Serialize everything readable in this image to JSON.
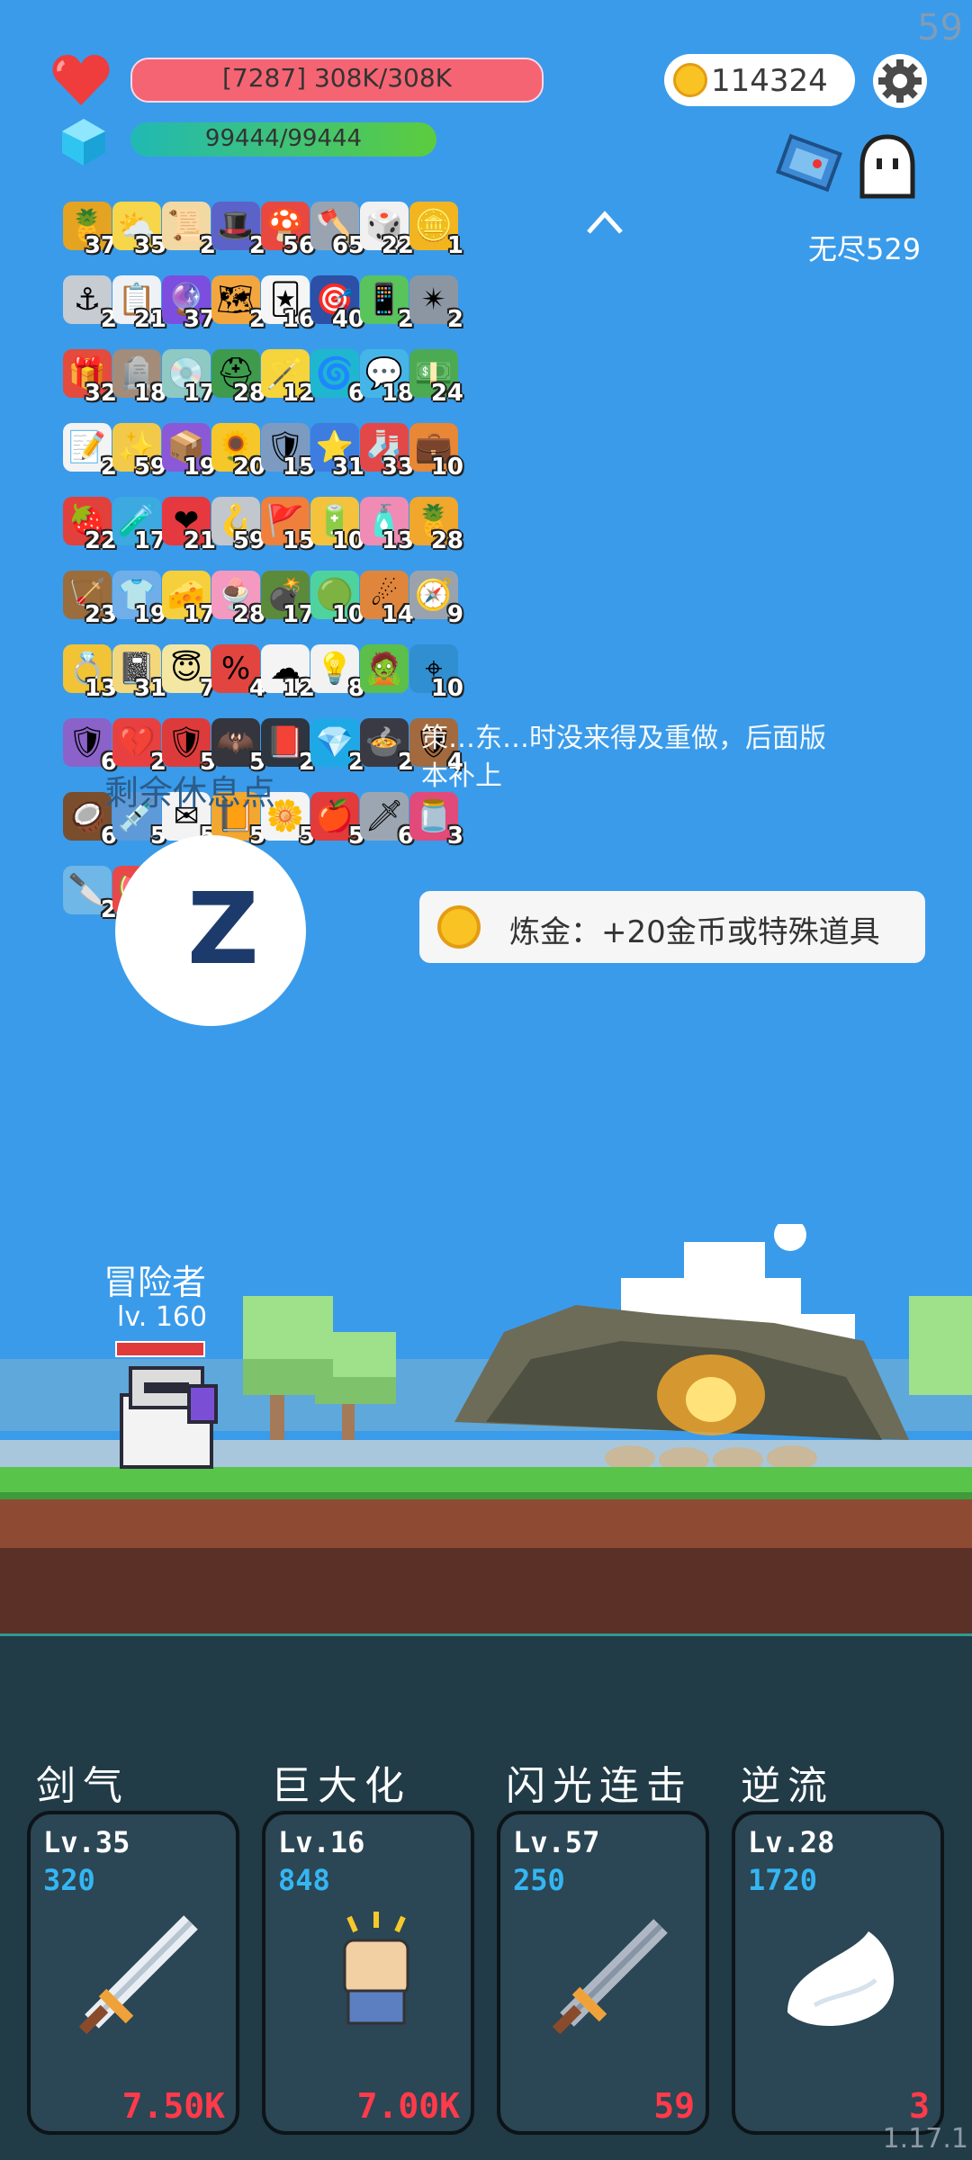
{
  "fps": "59",
  "hp": {
    "text": "[7287] 308K/308K",
    "fill": 1.0
  },
  "mp": {
    "text": "99444/99444",
    "fill": 1.0
  },
  "coins": "114324",
  "endless_label": "无尽529",
  "items": [
    {
      "count": "37",
      "icon": "pineapple-icon",
      "bg": "#e4a321",
      "glyph": "🍍"
    },
    {
      "count": "35",
      "icon": "sun-cloud-icon",
      "bg": "#f7d64a",
      "glyph": "⛅"
    },
    {
      "count": "2",
      "icon": "scroll-icon",
      "bg": "#f2d9a3",
      "glyph": "📜"
    },
    {
      "count": "2",
      "icon": "wizard-hat-icon",
      "bg": "#5b63c9",
      "glyph": "🎩"
    },
    {
      "count": "56",
      "icon": "mushroom-icon",
      "bg": "#e8483f",
      "glyph": "🍄"
    },
    {
      "count": "65",
      "icon": "axe-icon",
      "bg": "#9aa4b0",
      "glyph": "🪓"
    },
    {
      "count": "22",
      "icon": "dice-icon",
      "bg": "#f1f1f1",
      "glyph": "🎲"
    },
    {
      "count": "1",
      "icon": "coin-stack-icon",
      "bg": "#f2b51f",
      "glyph": "🪙"
    },
    {
      "count": "2",
      "icon": "hook-icon",
      "bg": "#c7ccd3",
      "glyph": "⚓"
    },
    {
      "count": "21",
      "icon": "clipboard-icon",
      "bg": "#eef2f6",
      "glyph": "📋"
    },
    {
      "count": "37",
      "icon": "crystal-ball-icon",
      "bg": "#7c4ee0",
      "glyph": "🔮"
    },
    {
      "count": "2",
      "icon": "treasure-map-icon",
      "bg": "#f3a640",
      "glyph": "🗺"
    },
    {
      "count": "16",
      "icon": "playing-cards-icon",
      "bg": "#f5f5f5",
      "glyph": "🃏"
    },
    {
      "count": "40",
      "icon": "target-icon",
      "bg": "#2d4fa5",
      "glyph": "🎯"
    },
    {
      "count": "2",
      "icon": "phone-icon",
      "bg": "#58c45b",
      "glyph": "📱"
    },
    {
      "count": "2",
      "icon": "spiked-ball-icon",
      "bg": "#8c96a2",
      "glyph": "✴"
    },
    {
      "count": "32",
      "icon": "gift-box-icon",
      "bg": "#e44b3c",
      "glyph": "🎁"
    },
    {
      "count": "18",
      "icon": "tombstone-icon",
      "bg": "#a38c7a",
      "glyph": "🪦"
    },
    {
      "count": "17",
      "icon": "disc-icon",
      "bg": "#8fc9c4",
      "glyph": "💿"
    },
    {
      "count": "28",
      "icon": "helmet-icon",
      "bg": "#3e9a4d",
      "glyph": "⛑"
    },
    {
      "count": "12",
      "icon": "magic-wand-icon",
      "bg": "#f5d53b",
      "glyph": "🪄"
    },
    {
      "count": "6",
      "icon": "spiral-icon",
      "bg": "#1fb7cf",
      "glyph": "🌀"
    },
    {
      "count": "18",
      "icon": "chat-bubble-icon",
      "bg": "#45b5e8",
      "glyph": "💬"
    },
    {
      "count": "24",
      "icon": "money-heart-icon",
      "bg": "#4caa53",
      "glyph": "💵"
    },
    {
      "count": "2",
      "icon": "checklist-icon",
      "bg": "#f3f3f3",
      "glyph": "📝"
    },
    {
      "count": "59",
      "icon": "molecule-icon",
      "bg": "#f3c94a",
      "glyph": "✨"
    },
    {
      "count": "19",
      "icon": "purple-box-icon",
      "bg": "#8b58d8",
      "glyph": "📦"
    },
    {
      "count": "20",
      "icon": "sunflower-icon",
      "bg": "#f5c72b",
      "glyph": "🌻"
    },
    {
      "count": "15",
      "icon": "shield-icon",
      "bg": "#7d9bc0",
      "glyph": "🛡"
    },
    {
      "count": "31",
      "icon": "star-card-icon",
      "bg": "#3d7de0",
      "glyph": "⭐"
    },
    {
      "count": "33",
      "icon": "sock-icon",
      "bg": "#e34848",
      "glyph": "🧦"
    },
    {
      "count": "10",
      "icon": "briefcase-icon",
      "bg": "#e88736",
      "glyph": "💼"
    },
    {
      "count": "22",
      "icon": "strawberry-icon",
      "bg": "#e2403a",
      "glyph": "🍓"
    },
    {
      "count": "17",
      "icon": "potion-flask-icon",
      "bg": "#3ca9e0",
      "glyph": "🧪"
    },
    {
      "count": "21",
      "icon": "heart-icon",
      "bg": "#e5393f",
      "glyph": "❤"
    },
    {
      "count": "59",
      "icon": "fishing-hook-icon",
      "bg": "#c2c7ce",
      "glyph": "🪝"
    },
    {
      "count": "15",
      "icon": "flag-hill-icon",
      "bg": "#ef7f3a",
      "glyph": "🚩"
    },
    {
      "count": "10",
      "icon": "battery-icon",
      "bg": "#f4c23d",
      "glyph": "🔋"
    },
    {
      "count": "13",
      "icon": "spray-bottle-icon",
      "bg": "#f08bb5",
      "glyph": "🧴"
    },
    {
      "count": "28",
      "icon": "pineapple-small-icon",
      "bg": "#f1a62c",
      "glyph": "🍍"
    },
    {
      "count": "23",
      "icon": "crossbow-icon",
      "bg": "#9b6d3c",
      "glyph": "🏹"
    },
    {
      "count": "19",
      "icon": "shirt-icon",
      "bg": "#6faee8",
      "glyph": "👕"
    },
    {
      "count": "17",
      "icon": "cheese-icon",
      "bg": "#f6cf3d",
      "glyph": "🧀"
    },
    {
      "count": "28",
      "icon": "ice-cream-icon",
      "bg": "#f49ac1",
      "glyph": "🍨"
    },
    {
      "count": "17",
      "icon": "grenade-icon",
      "bg": "#5b8a3b",
      "glyph": "💣"
    },
    {
      "count": "10",
      "icon": "slime-icon",
      "bg": "#4fd39e",
      "glyph": "🟢"
    },
    {
      "count": "14",
      "icon": "meteor-icon",
      "bg": "#e0853c",
      "glyph": "☄"
    },
    {
      "count": "9",
      "icon": "compass-icon",
      "bg": "#9aa3ad",
      "glyph": "🧭"
    },
    {
      "count": "13",
      "icon": "ring-icon",
      "bg": "#f2c335",
      "glyph": "💍"
    },
    {
      "count": "31",
      "icon": "note-pencil-icon",
      "bg": "#f3d77b",
      "glyph": "📓"
    },
    {
      "count": "7",
      "icon": "halo-icon",
      "bg": "#f4e7a4",
      "glyph": "😇"
    },
    {
      "count": "4",
      "icon": "discount-tag-icon",
      "bg": "#e2443f",
      "glyph": "%"
    },
    {
      "count": "12",
      "icon": "cloud-icon",
      "bg": "#f4f4f4",
      "glyph": "☁"
    },
    {
      "count": "8",
      "icon": "lightbulb-icon",
      "bg": "#f2f2f2",
      "glyph": "💡"
    },
    {
      "count": "",
      "icon": "zombie-icon",
      "bg": "#5bbf4a",
      "glyph": "🧟"
    },
    {
      "count": "10",
      "icon": "crosshair-icon",
      "bg": "#2f8fd1",
      "glyph": "⌖"
    },
    {
      "count": "6",
      "icon": "purple-shield-icon",
      "bg": "#8b62c9",
      "glyph": "🛡"
    },
    {
      "count": "2",
      "icon": "broken-heart-icon",
      "bg": "#e84040",
      "glyph": "💔"
    },
    {
      "count": "5",
      "icon": "red-shield-icon",
      "bg": "#dd3b3b",
      "glyph": "🛡"
    },
    {
      "count": "5",
      "icon": "bat-icon",
      "bg": "#34353d",
      "glyph": "🦇"
    },
    {
      "count": "2",
      "icon": "skull-book-icon",
      "bg": "#2c3540",
      "glyph": "📕"
    },
    {
      "count": "2",
      "icon": "blue-gem-icon",
      "bg": "#1fa8e6",
      "glyph": "💎"
    },
    {
      "count": "2",
      "icon": "cauldron-icon",
      "bg": "#3a3a44",
      "glyph": "🍲"
    },
    {
      "count": "4",
      "icon": "wooden-shield-icon",
      "bg": "#a26a3e",
      "glyph": "🛡"
    },
    {
      "count": "6",
      "icon": "coconut-icon",
      "bg": "#7a4e2d",
      "glyph": "🥥"
    },
    {
      "count": "5",
      "icon": "syringe-icon",
      "bg": "#5f9ad8",
      "glyph": "💉"
    },
    {
      "count": "5",
      "icon": "envelope-icon",
      "bg": "#f3f3f3",
      "glyph": "✉"
    },
    {
      "count": "5",
      "icon": "book-icon",
      "bg": "#f2a830",
      "glyph": "📙"
    },
    {
      "count": "5",
      "icon": "flower-icon",
      "bg": "#f4f4f4",
      "glyph": "🌼"
    },
    {
      "count": "5",
      "icon": "apple-icon",
      "bg": "#e33a3a",
      "glyph": "🍎"
    },
    {
      "count": "6",
      "icon": "sword-icon",
      "bg": "#9ca6b2",
      "glyph": "🗡"
    },
    {
      "count": "3",
      "icon": "jam-jar-icon",
      "bg": "#e24a7a",
      "glyph": "🫙"
    },
    {
      "count": "2",
      "icon": "scalpel-icon",
      "bg": "#6fb7e6",
      "glyph": "🔪"
    },
    {
      "count": "2",
      "icon": "watermelon-icon",
      "bg": "#e84848",
      "glyph": "🍉"
    },
    {
      "count": "",
      "icon": "lightbulb-card-icon",
      "bg": "#2f7f86",
      "glyph": "💡"
    }
  ],
  "note_text": "策…东…时没来得及重做，后面版本补上",
  "rest_label": "剩余休息点",
  "sleep_glyph": "Z",
  "tooltip_text": "炼金：+20金币或特殊道具",
  "hero": {
    "name": "冒险者",
    "level": "lv. 160",
    "hp_fill": 1.0
  },
  "skills": [
    {
      "name": "剑气",
      "level": "Lv.35",
      "cost": "320",
      "price": "7.50K",
      "icon": "sword-icon"
    },
    {
      "name": "巨大化",
      "level": "Lv.16",
      "cost": "848",
      "price": "7.00K",
      "icon": "fist-icon"
    },
    {
      "name": "闪光连击",
      "level": "Lv.57",
      "cost": "250",
      "price": "59",
      "icon": "dagger-icon"
    },
    {
      "name": "逆流",
      "level": "Lv.28",
      "cost": "1720",
      "price": "3",
      "icon": "wing-icon"
    }
  ],
  "version": "1.17.1"
}
